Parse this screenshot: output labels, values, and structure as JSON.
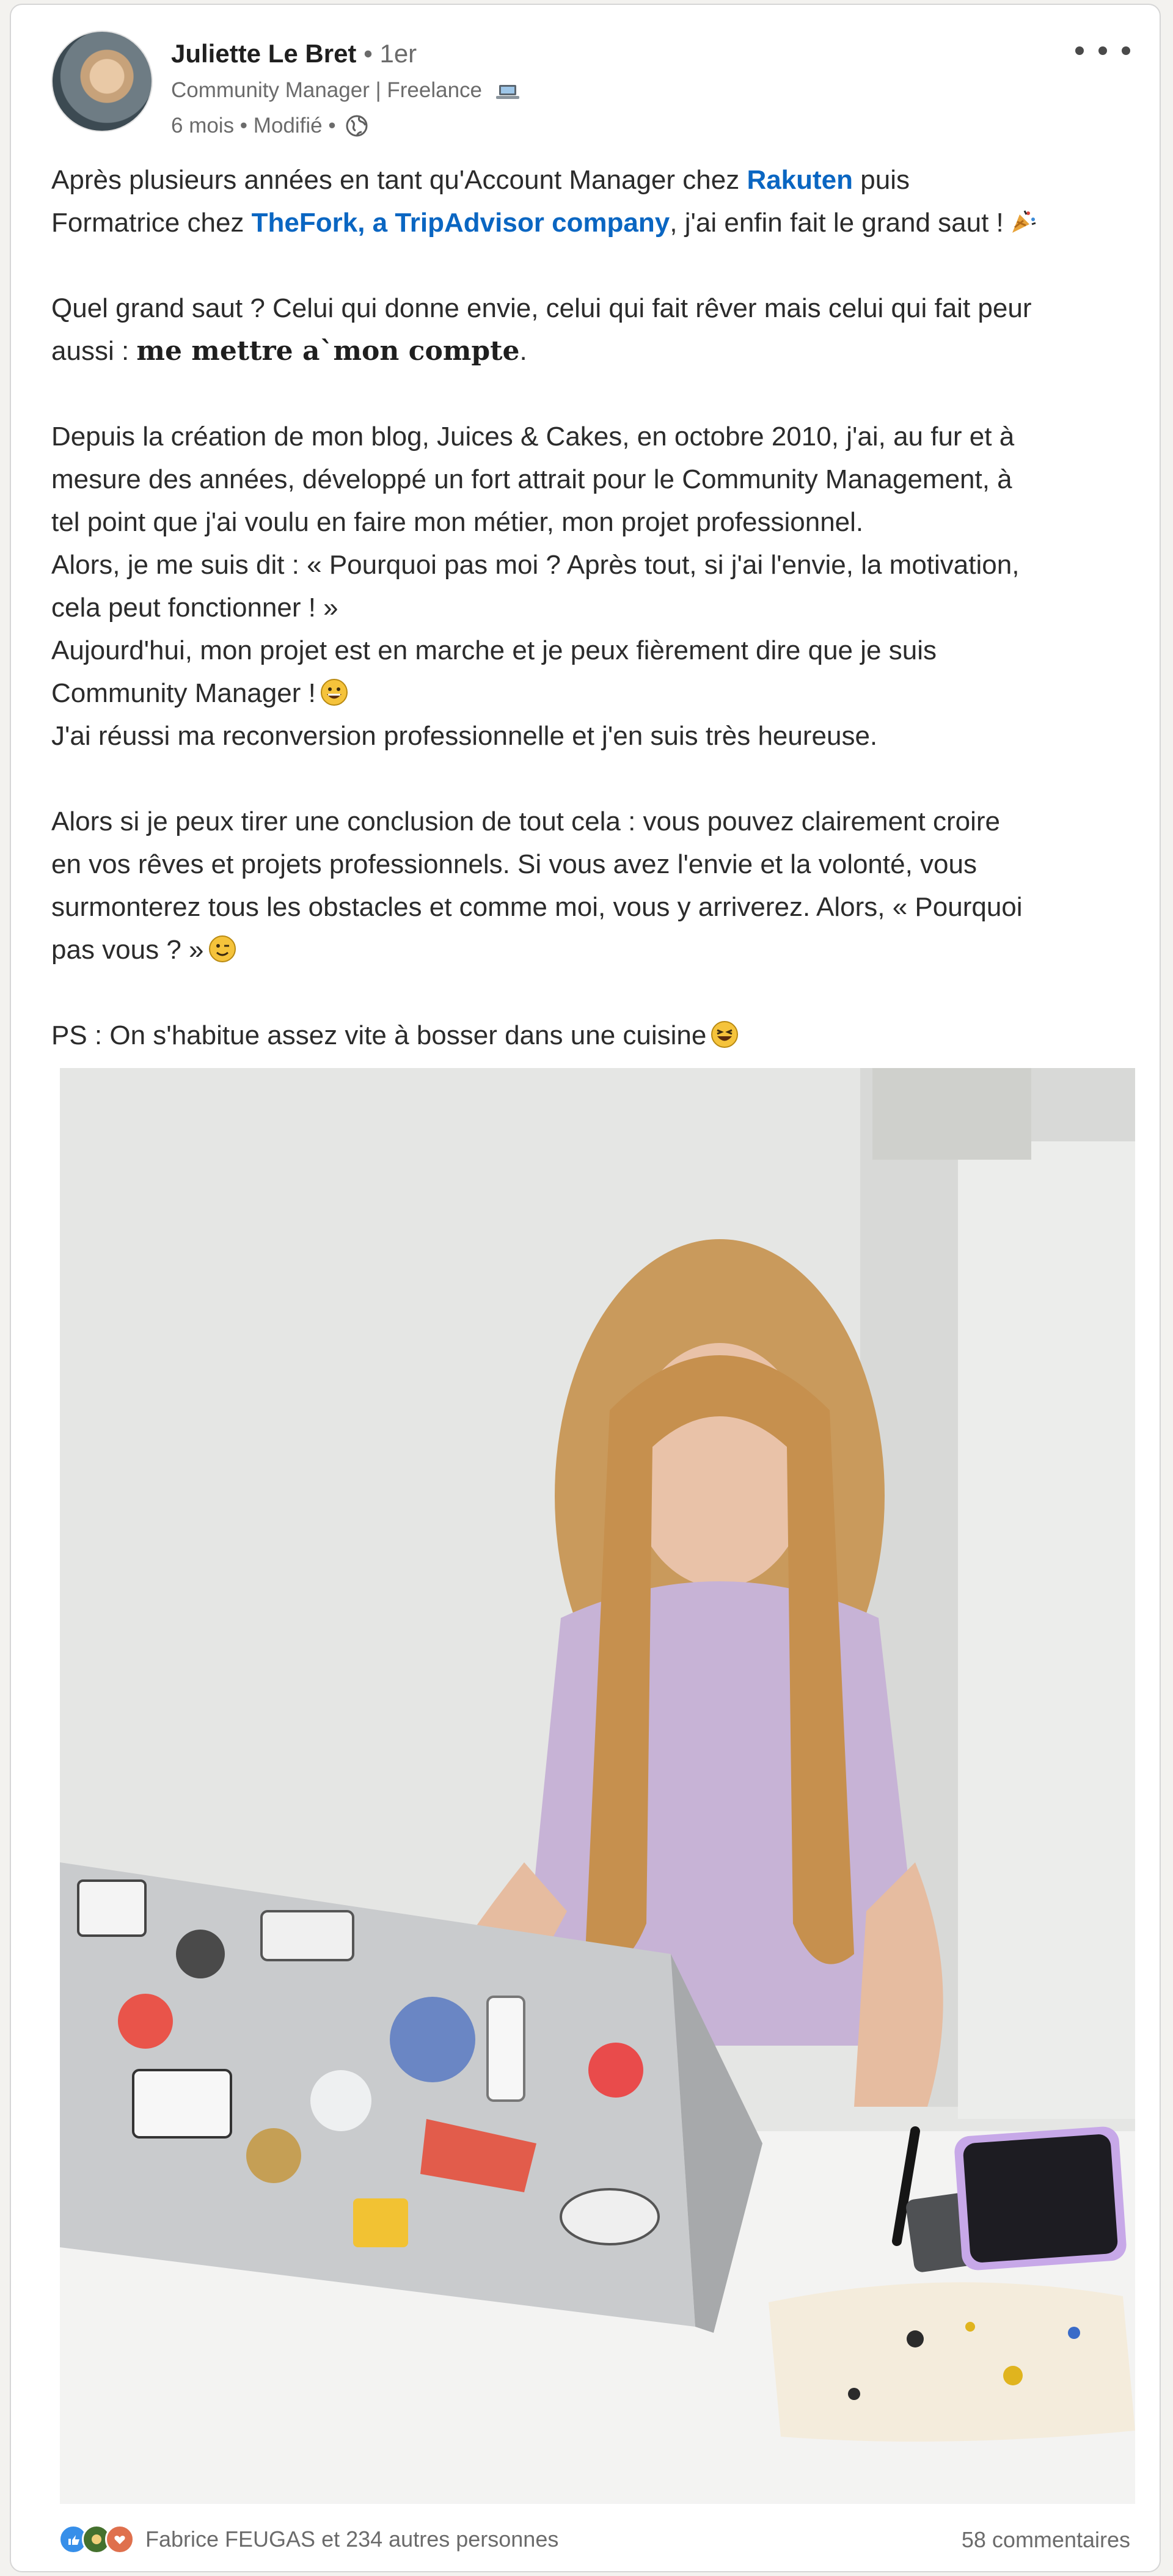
{
  "author": {
    "name": "Juliette Le Bret",
    "connection_degree": "• 1er",
    "headline": "Community Manager | Freelance",
    "meta": "6 mois • Modifié •"
  },
  "post": {
    "l1_a": "Après plusieurs années en tant qu'Account Manager chez ",
    "l1_mention": "Rakuten",
    "l1_b": " puis",
    "l2_a": "Formatrice chez ",
    "l2_mention": "TheFork, a TripAdvisor company",
    "l2_b": ", j'ai enfin fait le grand saut !",
    "l3": "Quel grand saut ? Celui qui donne envie, celui qui fait rêver mais celui qui fait peur",
    "l4_a": "aussi : ",
    "l4_bold": "me mettre a`mon compte",
    "l4_b": ".",
    "l5": "Depuis la création de mon blog, Juices & Cakes, en octobre 2010, j'ai, au fur et à",
    "l6": "mesure des années, développé un fort attrait pour le Community Management, à",
    "l7": "tel point que j'ai voulu en faire mon métier, mon projet professionnel.",
    "l8": "Alors, je me suis dit : « Pourquoi pas moi ? Après tout, si j'ai l'envie, la motivation,",
    "l9": "cela peut fonctionner ! »",
    "l10": "Aujourd'hui, mon projet est en marche et je peux fièrement dire que je suis",
    "l11": "Community Manager !",
    "l12": "J'ai réussi ma reconversion professionnelle et j'en suis très heureuse.",
    "l13": "Alors si je peux tirer une conclusion de tout cela : vous pouvez clairement croire",
    "l14": "en vos rêves et projets professionnels. Si vous avez l'envie et la volonté, vous",
    "l15": "surmonterez tous les obstacles et comme moi, vous y arriverez. Alors, « Pourquoi",
    "l16": "pas vous ? »",
    "l17": "PS : On s'habitue assez vite à bosser dans une cuisine"
  },
  "social": {
    "reactions_text": "Fabrice FEUGAS et 234 autres personnes",
    "comments": "58 commentaires"
  },
  "icons": {
    "more": "more-options-icon",
    "laptop": "laptop-icon",
    "globe": "globe-icon",
    "party": "party-popper-icon",
    "grin": "grinning-face-icon",
    "wink": "winking-face-icon",
    "laugh": "laughing-face-icon"
  },
  "colors": {
    "link": "#0a66c2",
    "muted": "#6b6b6b",
    "like": "#378fe9",
    "celebrate": "#44712e",
    "love": "#df704d"
  }
}
